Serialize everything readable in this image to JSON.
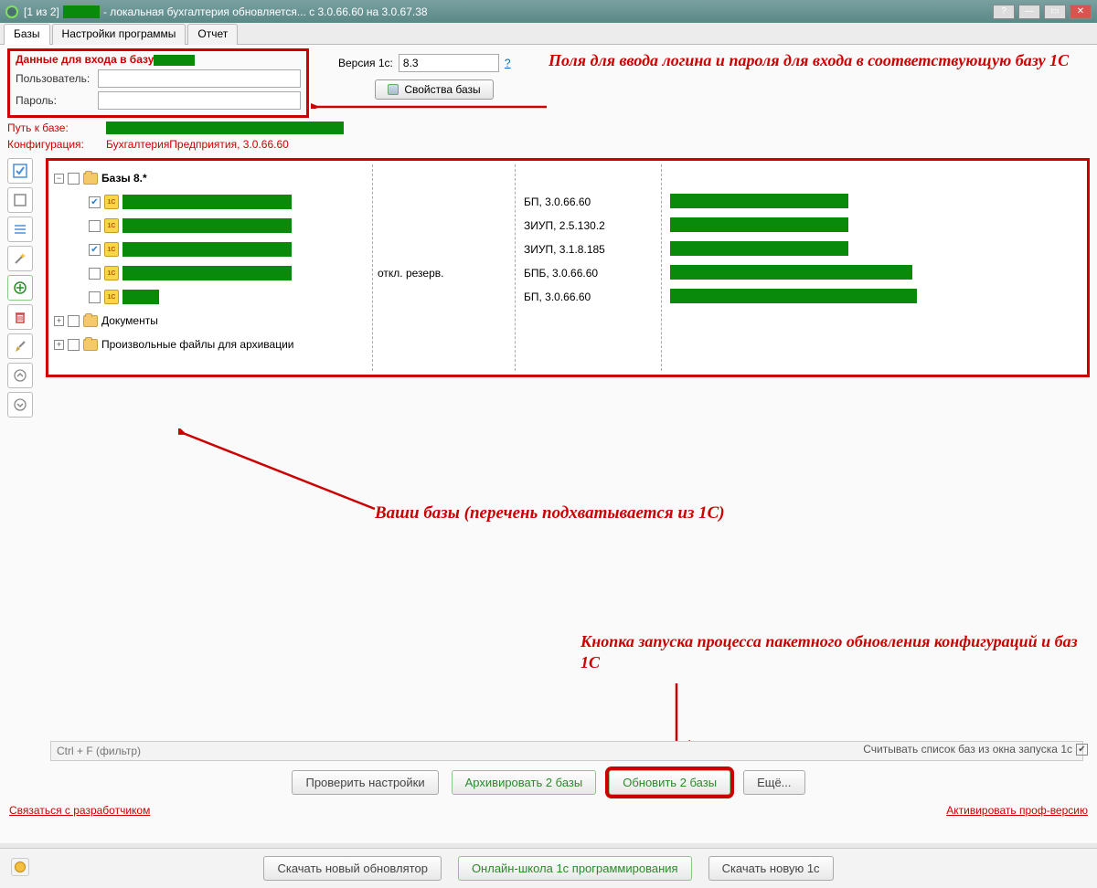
{
  "titlebar": {
    "prefix": "[1 из 2]",
    "suffix": "- локальная бухгалтерия обновляется... с 3.0.66.60 на 3.0.67.38"
  },
  "tabs": {
    "t1": "Базы",
    "t2": "Настройки программы",
    "t3": "Отчет"
  },
  "login": {
    "title": "Данные для входа в базу",
    "user_label": "Пользователь:",
    "pass_label": "Пароль:",
    "user_value": "",
    "pass_value": ""
  },
  "version": {
    "label": "Версия 1с:",
    "value": "8.3",
    "help": "?",
    "props_btn": "Свойства базы"
  },
  "path": {
    "label": "Путь к базе:"
  },
  "config": {
    "label": "Конфигурация:",
    "value": "БухгалтерияПредприятия, 3.0.66.60"
  },
  "annot": {
    "a1": "Поля для ввода логина и пароля для входа в соответствующую базу 1С",
    "a2": "Ваши базы (перечень подхватывается из 1С)",
    "a3": "Кнопка запуска процесса пакетного обновления конфигураций и баз 1С"
  },
  "tree": {
    "root": "Базы 8.*",
    "reserve": "откл. резерв.",
    "cfg1": "БП, 3.0.66.60",
    "cfg2": "ЗИУП, 2.5.130.2",
    "cfg3": "ЗИУП, 3.1.8.185",
    "cfg4": "БПБ, 3.0.66.60",
    "cfg5": "БП, 3.0.66.60",
    "docs": "Документы",
    "arch": "Произвольные файлы для архивации"
  },
  "filter": {
    "placeholder": "Ctrl + F (фильтр)"
  },
  "readlist": {
    "label": "Считывать список баз из окна запуска 1с"
  },
  "actions": {
    "check": "Проверить настройки",
    "archive": "Архивировать 2 базы",
    "update": "Обновить 2 базы",
    "more": "Ещё..."
  },
  "links": {
    "contact": "Связаться с разработчиком",
    "activate": "Активировать проф-версию"
  },
  "footer": {
    "download_updater": "Скачать новый обновлятор",
    "school": "Онлайн-школа 1с программирования",
    "download_1c": "Скачать новую 1с"
  }
}
